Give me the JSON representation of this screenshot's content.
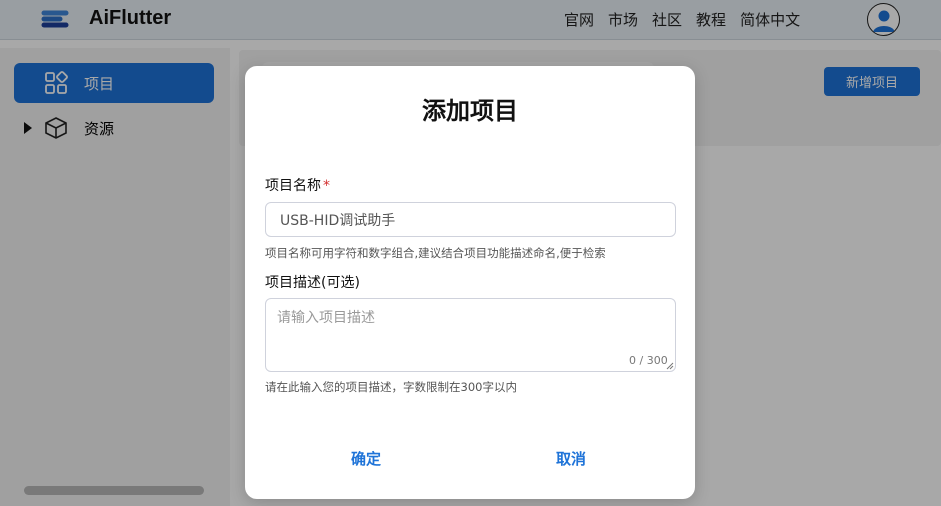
{
  "app": {
    "brand": "AiFlutter",
    "nav": [
      "官网",
      "市场",
      "社区",
      "教程",
      "简体中文"
    ]
  },
  "sidebar": {
    "items": [
      {
        "label": "项目",
        "icon": "grid-apps-icon",
        "active": true
      },
      {
        "label": "资源",
        "icon": "cube-icon",
        "expandable": true
      }
    ]
  },
  "main": {
    "add_button": "新增项目"
  },
  "dialog": {
    "title": "添加项目",
    "name_label": "项目名称",
    "required_mark": "*",
    "name_value": "USB-HID调试助手",
    "name_help": "项目名称可用字符和数字组合,建议结合项目功能描述命名,便于检索",
    "desc_label": "项目描述(可选)",
    "desc_placeholder": "请输入项目描述",
    "desc_counter": "0 / 300",
    "desc_help": "请在此输入您的项目描述，字数限制在300字以内",
    "confirm": "确定",
    "cancel": "取消"
  },
  "colors": {
    "accent": "#1e73d8",
    "required": "#d32f2f"
  }
}
